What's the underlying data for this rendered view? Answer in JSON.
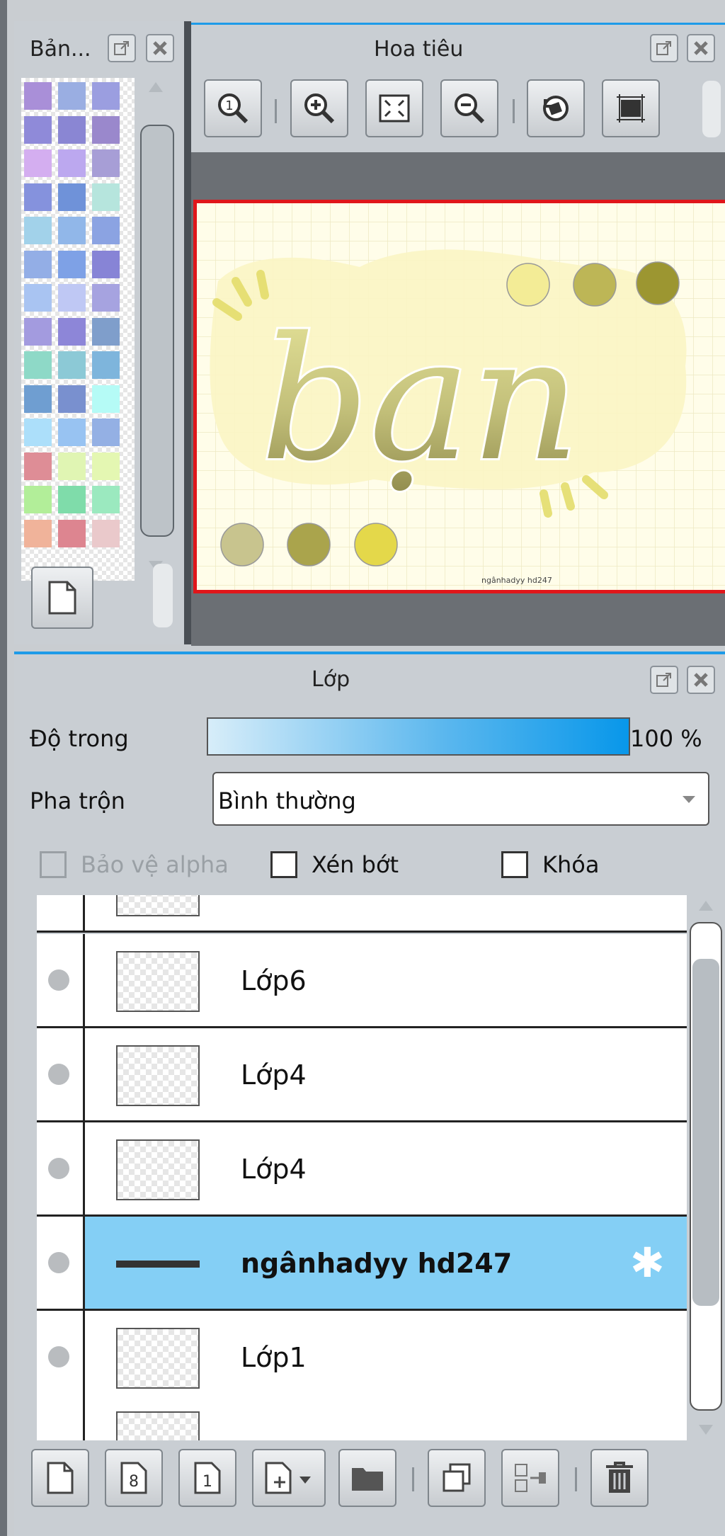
{
  "palette_panel": {
    "title": "Bản...",
    "colors": [
      "#a98fd8",
      "#9aaee2",
      "#9b9ee0",
      "#8f8ad9",
      "#8a86d3",
      "#9a88cc",
      "#d4aef0",
      "#bca8ef",
      "#a79ed6",
      "#8592dd",
      "#6f92d9",
      "#b6e5dd",
      "#a2d2ea",
      "#91b7e9",
      "#8ba3e2",
      "#93aee6",
      "#7ea1e6",
      "#8784d6",
      "#a9c4f2",
      "#bfc8f4",
      "#a6a3e0",
      "#a39bdf",
      "#8d86d8",
      "#7f9ecb",
      "#8ed9c7",
      "#8cc9d6",
      "#7eb5dc",
      "#6f9ed1",
      "#7990cf",
      "#b5fbf6",
      "#acdffa",
      "#98c3f2",
      "#94b0e4",
      "#de8d96",
      "#e0f5b3",
      "#e4f7b2",
      "#b2ee99",
      "#7fdcaa",
      "#9be9bf",
      "#f0b39a",
      "#dd8590",
      "#eac9cb"
    ]
  },
  "navigator_panel": {
    "title": "Hoa tiêu",
    "tools": [
      {
        "name": "zoom-100-icon"
      },
      {
        "name": "zoom-in-icon"
      },
      {
        "name": "fit-screen-icon"
      },
      {
        "name": "zoom-out-icon"
      },
      {
        "name": "rotate-icon"
      },
      {
        "name": "frame-icon"
      }
    ],
    "canvas_word": "bạn",
    "canvas_signature": "ngânhadyy hd247"
  },
  "layers_panel": {
    "title": "Lớp",
    "opacity_label": "Độ trong",
    "opacity_value": "100 %",
    "opacity_fraction": 1.0,
    "blend_label": "Pha trộn",
    "blend_value": "Bình thường",
    "protect_alpha_label": "Bảo vệ alpha",
    "clipping_label": "Xén bớt",
    "lock_label": "Khóa",
    "layers": [
      {
        "name": "Lớp6",
        "selected": false
      },
      {
        "name": "Lớp4",
        "selected": false
      },
      {
        "name": "Lớp4",
        "selected": false
      },
      {
        "name": "ngânhadyy hd247",
        "selected": true
      },
      {
        "name": "Lớp1",
        "selected": false
      }
    ],
    "bottom_tools": [
      {
        "name": "new-layer-icon",
        "glyph": ""
      },
      {
        "name": "new-8bit-layer-icon",
        "glyph": "8"
      },
      {
        "name": "new-1bit-layer-icon",
        "glyph": "1"
      },
      {
        "name": "add-layer-menu-icon",
        "glyph": ""
      },
      {
        "name": "new-folder-icon",
        "glyph": ""
      },
      {
        "name": "duplicate-layer-icon",
        "glyph": ""
      },
      {
        "name": "merge-down-icon",
        "glyph": ""
      },
      {
        "name": "delete-layer-icon",
        "glyph": ""
      }
    ]
  },
  "colors": {
    "accent_blue": "#1e9be8",
    "selected_row": "#84cff5",
    "canvas_border": "#e0161a"
  }
}
